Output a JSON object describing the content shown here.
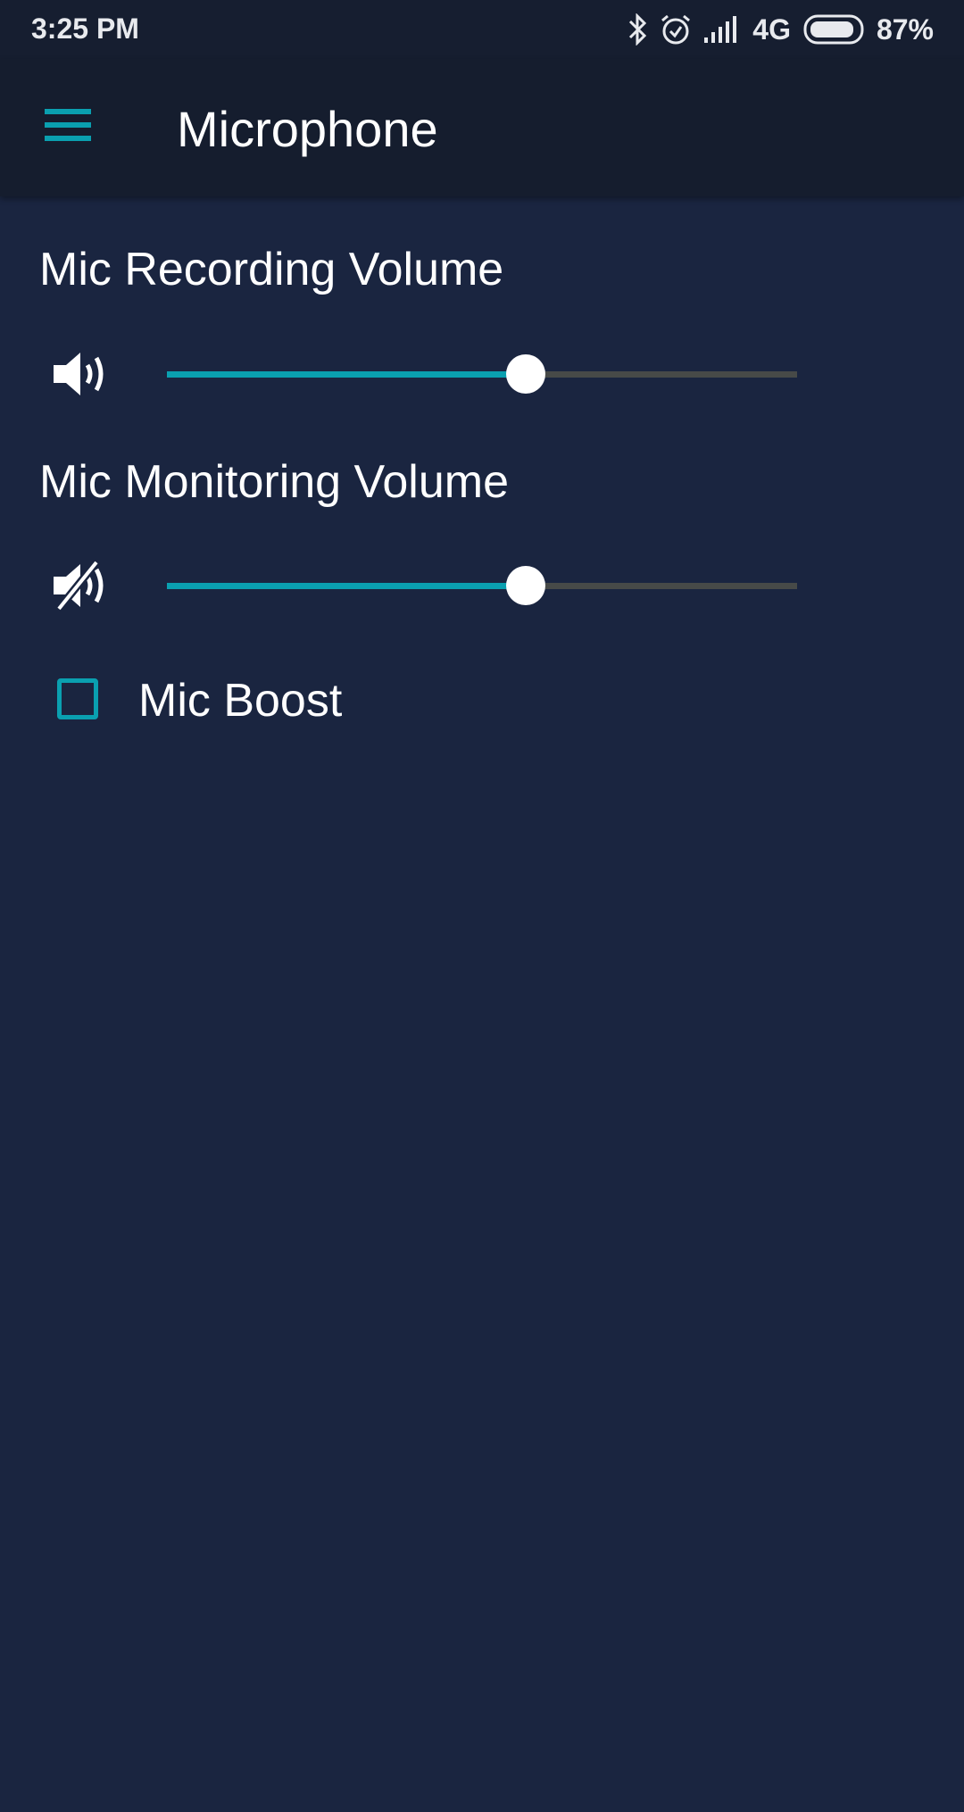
{
  "status_bar": {
    "time": "3:25 PM",
    "network": "4G",
    "battery_percent": "87%",
    "icons": [
      "bluetooth-icon",
      "alarm-icon",
      "signal-icon",
      "battery-icon"
    ]
  },
  "app_bar": {
    "menu_icon": "hamburger-menu-icon",
    "title": "Microphone"
  },
  "settings": {
    "recording_volume": {
      "label": "Mic Recording Volume",
      "icon": "speaker-icon",
      "value_fraction": 0.57
    },
    "monitoring_volume": {
      "label": "Mic Monitoring Volume",
      "icon": "speaker-muted-icon",
      "value_fraction": 0.57
    },
    "mic_boost": {
      "label": "Mic Boost",
      "checked": false
    }
  },
  "colors": {
    "accent": "#0aa0b0",
    "background": "#1a2540",
    "appbar": "#151d2e",
    "track_inactive": "#474a48"
  }
}
